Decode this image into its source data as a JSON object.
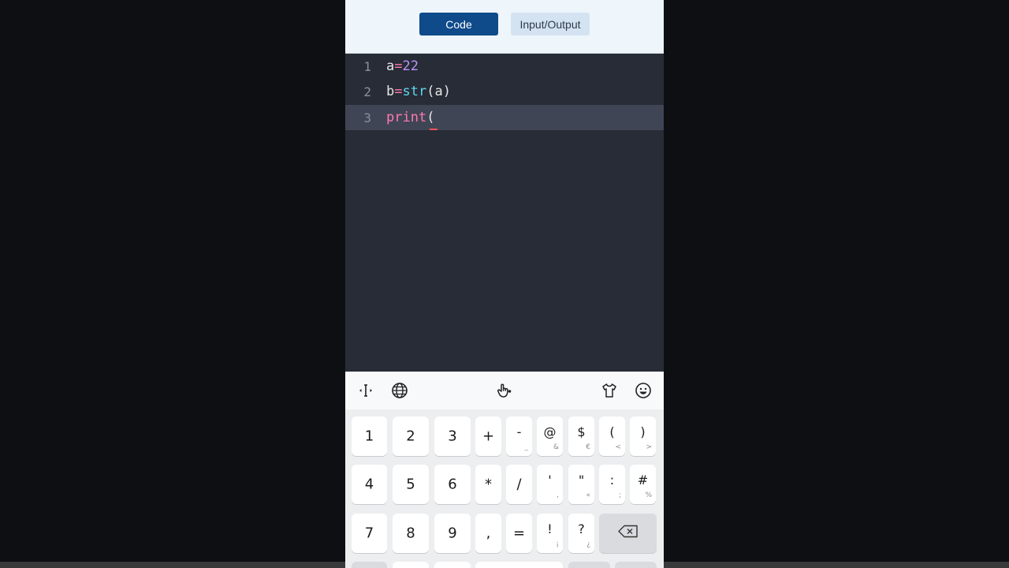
{
  "tabs": {
    "code": "Code",
    "io": "Input/Output"
  },
  "editor": {
    "lines": [
      {
        "num": "1",
        "tokens": [
          [
            "plain",
            "a"
          ],
          [
            "op",
            "="
          ],
          [
            "num",
            "22"
          ]
        ]
      },
      {
        "num": "2",
        "tokens": [
          [
            "plain",
            "b"
          ],
          [
            "op",
            "="
          ],
          [
            "fn",
            "str"
          ],
          [
            "plain",
            "(a)"
          ]
        ]
      },
      {
        "num": "3",
        "tokens": [
          [
            "kw",
            "print"
          ],
          [
            "plain",
            "("
          ]
        ]
      }
    ],
    "active_line": 3
  },
  "keyboard": {
    "toolbar": [
      "text-cursor-icon",
      "globe-icon",
      "touch-gesture-icon",
      "theme-shirt-icon",
      "emoji-icon"
    ],
    "rows": [
      [
        [
          "1",
          ""
        ],
        [
          "2",
          ""
        ],
        [
          "3",
          ""
        ],
        [
          "+",
          ""
        ],
        [
          "-",
          "_"
        ],
        [
          "@",
          "&"
        ],
        [
          "$",
          "€"
        ],
        [
          "(",
          "<"
        ],
        [
          ")",
          ">"
        ]
      ],
      [
        [
          "4",
          ""
        ],
        [
          "5",
          ""
        ],
        [
          "6",
          ""
        ],
        [
          "*",
          ""
        ],
        [
          "/",
          ""
        ],
        [
          "'",
          ","
        ],
        [
          "\"",
          "«"
        ],
        [
          ":",
          ";"
        ],
        [
          "#",
          "%"
        ]
      ],
      [
        [
          "7",
          ""
        ],
        [
          "8",
          ""
        ],
        [
          "9",
          ""
        ],
        [
          ",",
          ""
        ],
        [
          "=",
          ""
        ],
        [
          "!",
          "¡"
        ],
        [
          "?",
          "¿"
        ]
      ]
    ]
  }
}
